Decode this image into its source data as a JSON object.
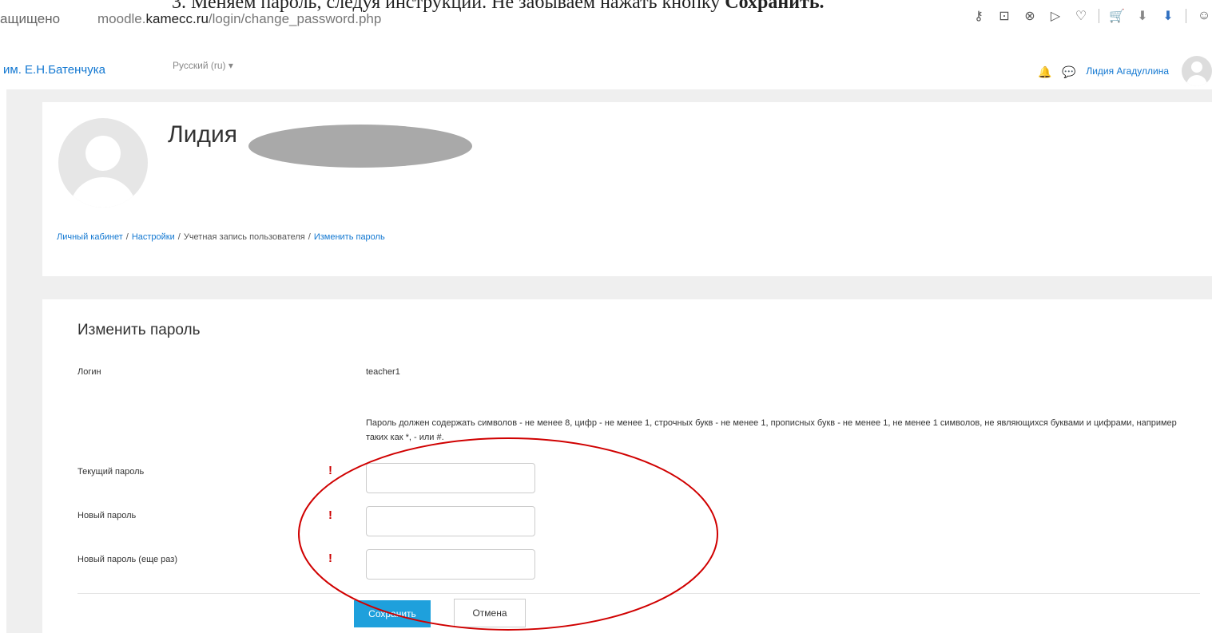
{
  "document": {
    "instruction_prefix": "3.   Меняем пароль, следуя инструкции. Не забываем нажать кнопку ",
    "instruction_bold": "Сохранить."
  },
  "browser": {
    "secure_label": "ащищено",
    "url_domain_prefix": "moodle.",
    "url_domain": "kamecc.ru",
    "url_path": "/login/change_password.php"
  },
  "navbar": {
    "site_name": "им. Е.Н.Батенчука",
    "language": "Русский (ru) ▾",
    "user_name": "Лидия Агадуллина"
  },
  "profile": {
    "name_visible": "Лидия",
    "breadcrumb": [
      {
        "label": "Личный кабинет"
      },
      {
        "label": "Настройки"
      },
      {
        "label": "Учетная запись пользователя"
      },
      {
        "label": "Изменить пароль"
      }
    ]
  },
  "form": {
    "title": "Изменить пароль",
    "login_label": "Логин",
    "login_value": "teacher1",
    "policy_text": "Пароль должен содержать символов - не менее 8, цифр - не менее 1, строчных букв - не менее 1, прописных букв - не менее 1, не менее 1 символов, не являющихся буквами и цифрами, например таких как *, - или #.",
    "current_password_label": "Текущий пароль",
    "new_password_label": "Новый пароль",
    "new_password_again_label": "Новый пароль (еще раз)",
    "required_icon": "!",
    "save_label": "Сохранить",
    "cancel_label": "Отмена"
  },
  "colors": {
    "link": "#1177d1",
    "primary_button": "#1ea0dc",
    "annotation": "#d00000"
  }
}
